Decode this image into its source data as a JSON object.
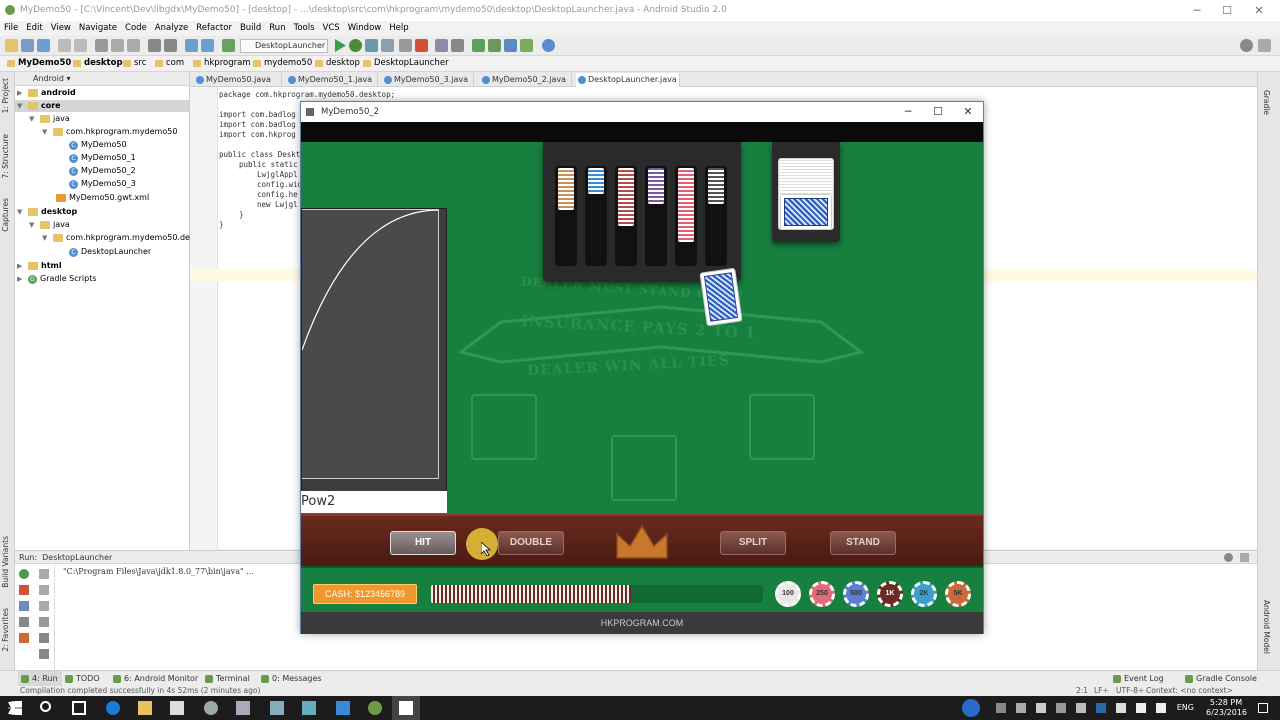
{
  "window": {
    "title": "MyDemo50 - [C:\\Vincent\\Dev\\libgdx\\MyDemo50] - [desktop] - ...\\desktop\\src\\com\\hkprogram\\mydemo50\\desktop\\DesktopLauncher.java - Android Studio 2.0"
  },
  "menu": [
    "File",
    "Edit",
    "View",
    "Navigate",
    "Code",
    "Analyze",
    "Refactor",
    "Build",
    "Run",
    "Tools",
    "VCS",
    "Window",
    "Help"
  ],
  "toolbar": {
    "run_config": "DesktopLauncher"
  },
  "breadcrumbs": [
    "MyDemo50",
    "desktop",
    "src",
    "com",
    "hkprogram",
    "mydemo50",
    "desktop",
    "DesktopLauncher"
  ],
  "project": {
    "view": "Android",
    "items": [
      {
        "label": "android",
        "type": "folder",
        "bold": true
      },
      {
        "label": "core",
        "type": "folder",
        "bold": true
      },
      {
        "label": "java",
        "type": "folder"
      },
      {
        "label": "com.hkprogram.mydemo50",
        "type": "folder"
      },
      {
        "label": "MyDemo50",
        "type": "class"
      },
      {
        "label": "MyDemo50_1",
        "type": "class"
      },
      {
        "label": "MyDemo50_2",
        "type": "class"
      },
      {
        "label": "MyDemo50_3",
        "type": "class"
      },
      {
        "label": "MyDemo50.gwt.xml",
        "type": "file"
      },
      {
        "label": "desktop",
        "type": "folder",
        "bold": true
      },
      {
        "label": "java",
        "type": "folder"
      },
      {
        "label": "com.hkprogram.mydemo50.deskto",
        "type": "folder"
      },
      {
        "label": "DesktopLauncher",
        "type": "class"
      },
      {
        "label": "html",
        "type": "folder",
        "bold": true
      },
      {
        "label": "Gradle Scripts",
        "type": "gradle"
      }
    ]
  },
  "editor_tabs": [
    "MyDemo50.java",
    "MyDemo50_1.java",
    "MyDemo50_3.java",
    "MyDemo50_2.java",
    "DesktopLauncher.java"
  ],
  "code": {
    "package_line": "package com.hkprogram.mydemo50.desktop;",
    "import1": "import com.badlog",
    "import2": "import com.badlog",
    "import3": "import com.hkprog",
    "class_line": "public class Deskt",
    "main_line": "public static",
    "l1": "LwjglAppl",
    "l2": "config.wid",
    "l3": "config.he",
    "l4": "new Lwjgl",
    "close1": "}",
    "close2": "}"
  },
  "left_tool_tabs": [
    "1: Project",
    "7: Structure",
    "Captures",
    "Build Variants",
    "2: Favorites"
  ],
  "right_tool_tabs": [
    "Gradle",
    "Android Model"
  ],
  "run_panel": {
    "header": "Run",
    "config": "DesktopLauncher",
    "output": "\"C:\\Program Files\\Java\\jdk1.8.0_77\\bin\\java\" ..."
  },
  "bottom_tabs": [
    "4: Run",
    "TODO",
    "6: Android Monitor",
    "Terminal",
    "0: Messages"
  ],
  "bottom_right_tabs": [
    "Event Log",
    "Gradle Console"
  ],
  "status": {
    "message": "Compilation completed successfully in 4s 52ms (2 minutes ago)",
    "position": "2:1",
    "line_sep": "LF÷",
    "encoding": "UTF-8÷",
    "context": "Context: <no context>"
  },
  "game": {
    "title": "MyDemo50_2",
    "table_line1": "DEALER MUST STAND ON 17",
    "table_line2": "INSURANCE PAYS 2 TO 1",
    "table_line3": "DEALER WIN ALL TIES",
    "pow_label": "Pow2",
    "buttons": {
      "hit": "HIT",
      "double": "DOUBLE",
      "split": "SPLIT",
      "stand": "STAND"
    },
    "cash": "CASH: $123456789",
    "chips": [
      {
        "label": "100",
        "color": "#e8e8e8"
      },
      {
        "label": "250",
        "color": "#e06b7a"
      },
      {
        "label": "500",
        "color": "#5a7fd0"
      },
      {
        "label": "1K",
        "color": "#6b2a22"
      },
      {
        "label": "2K",
        "color": "#3aa0c8"
      },
      {
        "label": "5K",
        "color": "#c86a3a"
      }
    ],
    "footer": "HKPROGRAM.COM"
  },
  "taskbar": {
    "time": "5:28 PM",
    "date": "6/23/2016",
    "lang": "ENG"
  }
}
